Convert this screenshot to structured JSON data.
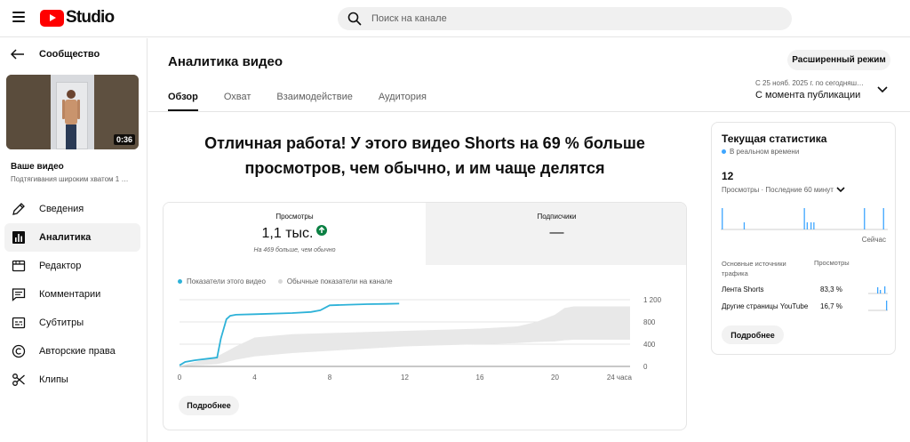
{
  "header": {
    "app_name": "Studio",
    "search_placeholder": "Поиск на канале"
  },
  "sidebar": {
    "back_label": "Сообщество",
    "video": {
      "duration": "0:36",
      "title": "Ваше видео",
      "subtitle": "Подтягивания широким хватом 1 …"
    },
    "items": [
      {
        "label": "Сведения",
        "icon": "pencil-icon",
        "active": false
      },
      {
        "label": "Аналитика",
        "icon": "analytics-icon",
        "active": true
      },
      {
        "label": "Редактор",
        "icon": "editor-icon",
        "active": false
      },
      {
        "label": "Комментарии",
        "icon": "comments-icon",
        "active": false
      },
      {
        "label": "Субтитры",
        "icon": "subtitles-icon",
        "active": false
      },
      {
        "label": "Авторские права",
        "icon": "copyright-icon",
        "active": false
      },
      {
        "label": "Клипы",
        "icon": "scissors-icon",
        "active": false
      }
    ]
  },
  "main": {
    "title": "Аналитика видео",
    "advanced_mode_label": "Расширенный режим",
    "tabs": [
      "Обзор",
      "Охват",
      "Взаимодействие",
      "Аудитория"
    ],
    "active_tab": "Обзор",
    "date_range": {
      "from_text": "С 25 нояб. 2025 г. по сегодняш…",
      "label": "С момента публикации"
    },
    "headline_line1": "Отличная работа! У этого видео Shorts на 69 % больше",
    "headline_line2": "просмотров, чем обычно, и им чаще делятся",
    "metrics": {
      "views_label": "Просмотры",
      "views_value": "1,1 тыс.",
      "views_note": "На 469 больше, чем обычно",
      "subs_label": "Подписчики",
      "subs_value": "—"
    },
    "legend": {
      "this_video": "Показатели этого видео",
      "typical": "Обычные показатели на канале"
    },
    "more_label": "Подробнее"
  },
  "chart_data": {
    "type": "line",
    "x_ticks": [
      "0",
      "4",
      "8",
      "12",
      "16",
      "20",
      "24 часа"
    ],
    "y_ticks": [
      "0",
      "400",
      "800",
      "1 200"
    ],
    "ylim": [
      0,
      1200
    ],
    "xlim": [
      0,
      24
    ],
    "series": [
      {
        "name": "Показатели этого видео",
        "color": "#2eb2d8",
        "x": [
          0,
          0.3,
          0.8,
          1.5,
          2.0,
          2.2,
          2.5,
          2.7,
          3.0,
          4.0,
          6.0,
          7.0,
          7.5,
          8.0,
          9.0,
          10.0,
          11.0,
          11.7
        ],
        "y": [
          20,
          80,
          110,
          140,
          160,
          500,
          850,
          910,
          930,
          940,
          960,
          980,
          1010,
          1100,
          1110,
          1120,
          1125,
          1130
        ]
      },
      {
        "name": "Обычные показатели на канале",
        "color": "#e8e8e8",
        "type": "band",
        "x": [
          0,
          2,
          3,
          4,
          6,
          8,
          10,
          12,
          14,
          16,
          18,
          19,
          20,
          20.5,
          21,
          24
        ],
        "upper": [
          10,
          180,
          360,
          520,
          580,
          600,
          620,
          640,
          660,
          680,
          720,
          800,
          930,
          1050,
          1080,
          1080
        ],
        "lower": [
          0,
          40,
          120,
          180,
          240,
          280,
          320,
          360,
          380,
          400,
          420,
          440,
          450,
          470,
          480,
          480
        ]
      }
    ]
  },
  "realtime": {
    "title": "Текущая статистика",
    "live_label": "В реальном времени",
    "count": "12",
    "subtitle": "Просмотры · Последние 60 минут",
    "now_label": "Сейчас",
    "bars_color": "#3ea6ff",
    "bars": [
      0,
      3,
      0,
      0,
      0,
      0,
      0,
      0,
      0,
      0,
      0,
      0,
      0,
      0,
      0,
      0,
      0,
      0,
      0,
      0,
      0,
      0,
      0,
      0,
      1,
      0,
      0,
      0,
      0,
      0,
      0,
      0,
      0,
      0,
      0,
      0,
      0,
      0,
      0,
      0,
      0,
      0,
      0,
      0,
      0,
      0,
      0,
      0,
      0,
      0,
      0,
      0,
      0,
      0,
      0,
      0,
      0,
      0,
      0,
      0,
      0,
      0,
      0,
      0,
      0,
      0,
      0,
      0,
      0,
      0,
      0,
      0,
      0,
      0,
      0,
      0,
      0,
      0,
      0,
      0,
      0,
      0,
      0,
      0,
      0,
      0,
      0,
      3,
      0,
      0,
      1,
      0,
      0,
      0,
      1,
      0,
      0,
      1,
      0,
      0,
      0,
      0,
      0,
      0,
      0,
      0,
      0,
      0,
      0,
      0,
      0,
      0,
      0,
      0,
      0,
      0,
      0,
      0,
      0,
      0,
      0,
      0,
      0,
      0,
      0,
      0,
      0,
      0,
      0,
      0,
      0,
      0,
      0,
      0,
      0,
      0,
      0,
      0,
      0,
      0,
      0,
      0,
      0,
      0,
      0,
      0,
      0,
      0,
      0,
      0,
      3,
      0,
      0,
      0,
      0,
      0,
      0,
      0,
      0,
      0,
      0,
      0,
      0,
      0,
      0,
      0,
      0,
      0,
      0,
      0,
      3,
      0,
      0,
      0,
      0
    ],
    "sources_header": "Основные источники трафика",
    "views_header": "Просмотры",
    "sources": [
      {
        "name": "Лента Shorts",
        "pct": "83,3 %"
      },
      {
        "name": "Другие страницы YouTube",
        "pct": "16,7 %"
      }
    ],
    "more_label": "Подробнее"
  }
}
